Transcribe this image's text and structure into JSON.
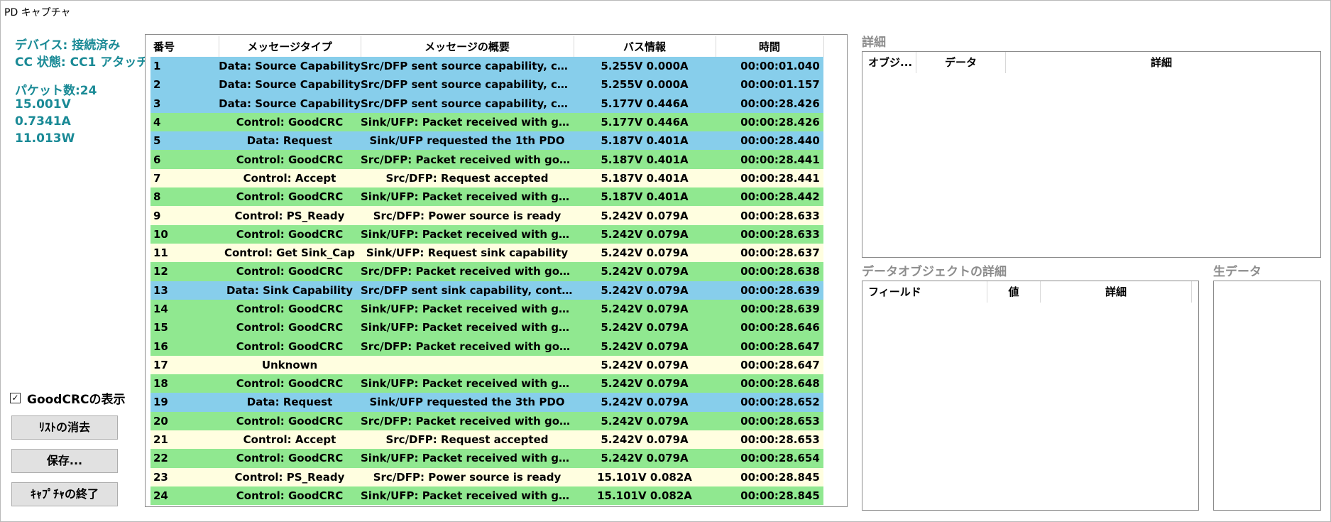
{
  "window": {
    "title": "PD キャプチャ"
  },
  "status": {
    "device": "デバイス: 接続済み",
    "cc_state": "CC 状態: CC1 アタッチ",
    "packet_count": "パケット数:24",
    "voltage": "15.001V",
    "current": "0.7341A",
    "power": "11.013W"
  },
  "controls": {
    "show_goodcrc_label": "GoodCRCの表示",
    "show_goodcrc_checked": true,
    "checkmark_glyph": "✓",
    "clear_list_label": "ﾘｽﾄの消去",
    "save_label": "保存...",
    "end_capture_label": "ｷｬﾌﾟﾁｬの終了"
  },
  "packet_table": {
    "headers": [
      "番号",
      "メッセージタイプ",
      "メッセージの概要",
      "バス情報",
      "時間"
    ],
    "rows": [
      {
        "num": "1",
        "type": "Data: Source Capability",
        "summary": "Src/DFP sent source capability, con...",
        "bus": "5.255V 0.000A",
        "time": "00:00:01.040",
        "color": "blue"
      },
      {
        "num": "2",
        "type": "Data: Source Capability",
        "summary": "Src/DFP sent source capability, con...",
        "bus": "5.255V 0.000A",
        "time": "00:00:01.157",
        "color": "blue"
      },
      {
        "num": "3",
        "type": "Data: Source Capability",
        "summary": "Src/DFP sent source capability, con...",
        "bus": "5.177V 0.446A",
        "time": "00:00:28.426",
        "color": "blue"
      },
      {
        "num": "4",
        "type": "Control: GoodCRC",
        "summary": "Sink/UFP: Packet received with goo...",
        "bus": "5.177V 0.446A",
        "time": "00:00:28.426",
        "color": "green"
      },
      {
        "num": "5",
        "type": "Data: Request",
        "summary": "Sink/UFP requested the 1th PDO",
        "bus": "5.187V 0.401A",
        "time": "00:00:28.440",
        "color": "blue"
      },
      {
        "num": "6",
        "type": "Control: GoodCRC",
        "summary": "Src/DFP: Packet received with good...",
        "bus": "5.187V 0.401A",
        "time": "00:00:28.441",
        "color": "green"
      },
      {
        "num": "7",
        "type": "Control: Accept",
        "summary": "Src/DFP: Request accepted",
        "bus": "5.187V 0.401A",
        "time": "00:00:28.441",
        "color": "yellow"
      },
      {
        "num": "8",
        "type": "Control: GoodCRC",
        "summary": "Sink/UFP: Packet received with goo...",
        "bus": "5.187V 0.401A",
        "time": "00:00:28.442",
        "color": "green"
      },
      {
        "num": "9",
        "type": "Control: PS_Ready",
        "summary": "Src/DFP: Power source is ready",
        "bus": "5.242V 0.079A",
        "time": "00:00:28.633",
        "color": "yellow"
      },
      {
        "num": "10",
        "type": "Control: GoodCRC",
        "summary": "Sink/UFP: Packet received with goo...",
        "bus": "5.242V 0.079A",
        "time": "00:00:28.633",
        "color": "green"
      },
      {
        "num": "11",
        "type": "Control: Get Sink_Cap",
        "summary": "Sink/UFP: Request sink capability",
        "bus": "5.242V 0.079A",
        "time": "00:00:28.637",
        "color": "yellow"
      },
      {
        "num": "12",
        "type": "Control: GoodCRC",
        "summary": "Src/DFP: Packet received with good...",
        "bus": "5.242V 0.079A",
        "time": "00:00:28.638",
        "color": "green"
      },
      {
        "num": "13",
        "type": "Data: Sink Capability",
        "summary": "Src/DFP sent sink capability, contai...",
        "bus": "5.242V 0.079A",
        "time": "00:00:28.639",
        "color": "blue"
      },
      {
        "num": "14",
        "type": "Control: GoodCRC",
        "summary": "Sink/UFP: Packet received with goo...",
        "bus": "5.242V 0.079A",
        "time": "00:00:28.639",
        "color": "green"
      },
      {
        "num": "15",
        "type": "Control: GoodCRC",
        "summary": "Sink/UFP: Packet received with goo...",
        "bus": "5.242V 0.079A",
        "time": "00:00:28.646",
        "color": "green"
      },
      {
        "num": "16",
        "type": "Control: GoodCRC",
        "summary": "Src/DFP: Packet received with good...",
        "bus": "5.242V 0.079A",
        "time": "00:00:28.647",
        "color": "green"
      },
      {
        "num": "17",
        "type": "Unknown",
        "summary": "",
        "bus": "5.242V 0.079A",
        "time": "00:00:28.647",
        "color": "yellow"
      },
      {
        "num": "18",
        "type": "Control: GoodCRC",
        "summary": "Sink/UFP: Packet received with goo...",
        "bus": "5.242V 0.079A",
        "time": "00:00:28.648",
        "color": "green"
      },
      {
        "num": "19",
        "type": "Data: Request",
        "summary": "Sink/UFP requested the 3th PDO",
        "bus": "5.242V 0.079A",
        "time": "00:00:28.652",
        "color": "blue"
      },
      {
        "num": "20",
        "type": "Control: GoodCRC",
        "summary": "Src/DFP: Packet received with good...",
        "bus": "5.242V 0.079A",
        "time": "00:00:28.653",
        "color": "green"
      },
      {
        "num": "21",
        "type": "Control: Accept",
        "summary": "Src/DFP: Request accepted",
        "bus": "5.242V 0.079A",
        "time": "00:00:28.653",
        "color": "yellow"
      },
      {
        "num": "22",
        "type": "Control: GoodCRC",
        "summary": "Sink/UFP: Packet received with goo...",
        "bus": "5.242V 0.079A",
        "time": "00:00:28.654",
        "color": "green"
      },
      {
        "num": "23",
        "type": "Control: PS_Ready",
        "summary": "Src/DFP: Power source is ready",
        "bus": "15.101V 0.082A",
        "time": "00:00:28.845",
        "color": "yellow"
      },
      {
        "num": "24",
        "type": "Control: GoodCRC",
        "summary": "Sink/UFP: Packet received with goo...",
        "bus": "15.101V 0.082A",
        "time": "00:00:28.845",
        "color": "green"
      }
    ]
  },
  "details_panel": {
    "title": "詳細",
    "headers": [
      "オブジ...",
      "データ",
      "詳細"
    ]
  },
  "data_object_panel": {
    "title": "データオブジェクトの詳細",
    "headers": [
      "フィールド",
      "値",
      "詳細"
    ]
  },
  "raw_data_panel": {
    "title": "生データ"
  },
  "colors": {
    "status_text": "#1a8a96",
    "row_green": "#90e890",
    "row_blue": "#87ceeb",
    "row_yellow": "#fffee0",
    "section_title": "#8c8c8c"
  }
}
